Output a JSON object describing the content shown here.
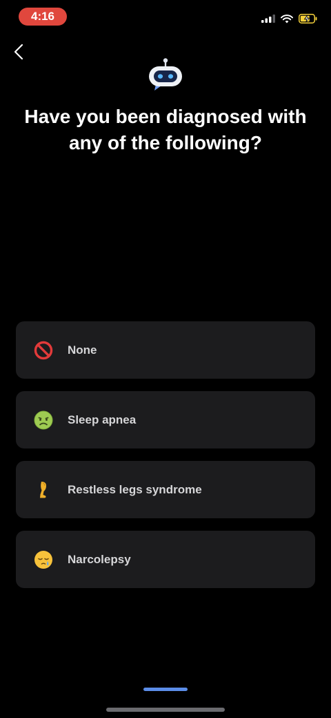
{
  "status_bar": {
    "time": "4:16",
    "time_pill_color": "#e0473d",
    "icons": [
      "cellular-signal-icon",
      "wifi-icon",
      "battery-charging-icon"
    ]
  },
  "nav": {
    "back_icon": "chevron-left-icon"
  },
  "logo_icon": "robot-chat-icon",
  "title": "Have you been diagnosed with any of the following?",
  "options": [
    {
      "label": "None",
      "icon": "prohibited-icon"
    },
    {
      "label": "Sleep apnea",
      "icon": "nauseated-face-icon"
    },
    {
      "label": "Restless legs syndrome",
      "icon": "leg-icon"
    },
    {
      "label": "Narcolepsy",
      "icon": "sleepy-face-icon"
    }
  ],
  "colors": {
    "background": "#000000",
    "card": "#1c1c1e",
    "accent": "#5b8de8"
  }
}
